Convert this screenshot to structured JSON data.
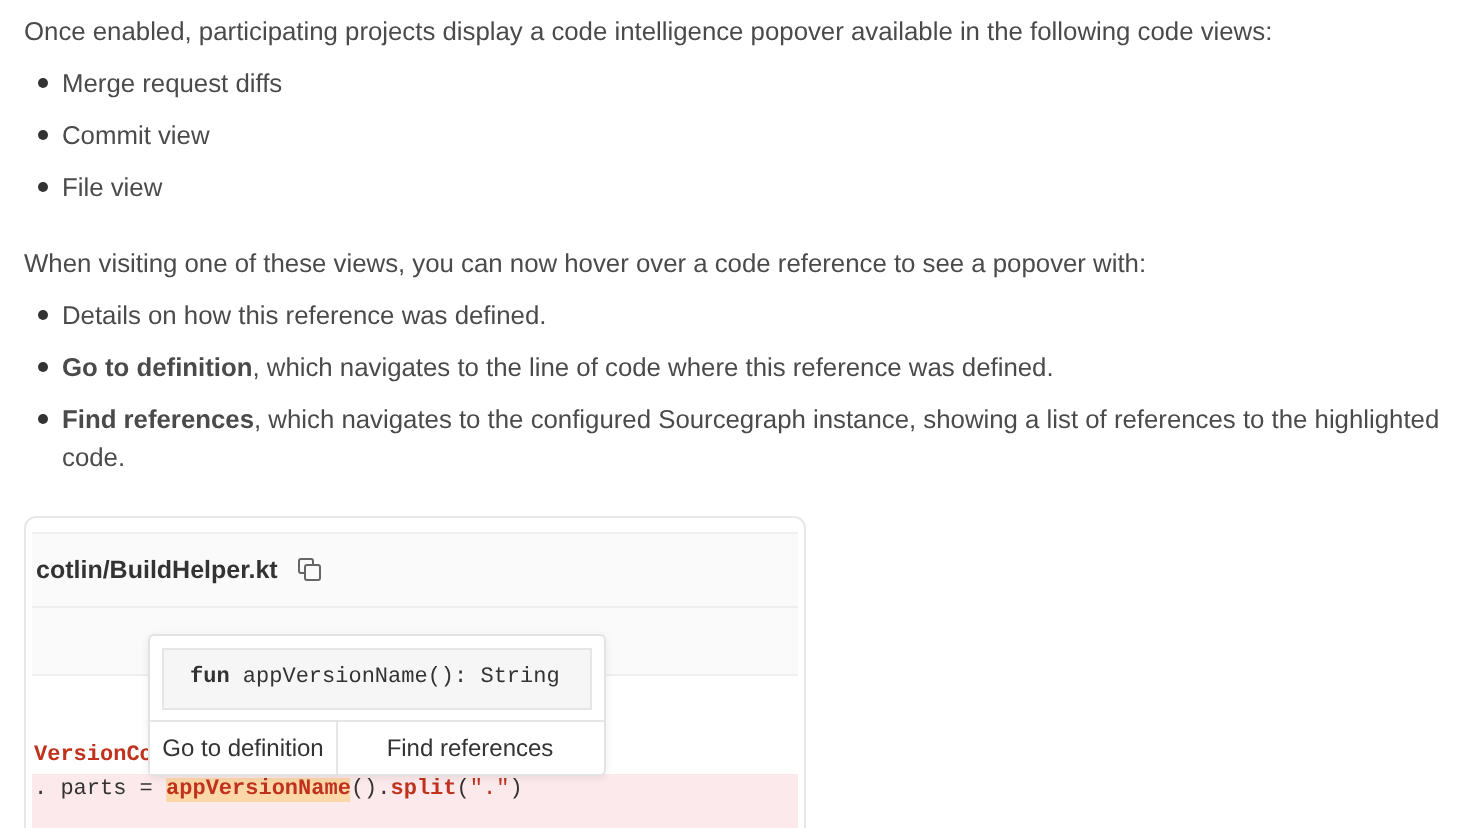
{
  "intro": "Once enabled, participating projects display a code intelligence popover available in the following code views:",
  "views": [
    "Merge request diffs",
    "Commit view",
    "File view"
  ],
  "hover_intro": "When visiting one of these views, you can now hover over a code reference to see a popover with:",
  "features": [
    "Details on how this reference was defined.",
    "**Go to definition**, which navigates to the line of code where this reference was defined.",
    "**Find references**, which navigates to the configured Sourcegraph instance, showing a list of references to the highlighted code."
  ],
  "screenshot": {
    "file_path": "cotlin/BuildHelper.kt",
    "code_lines": [
      {
        "kind": "plain",
        "tokens": [
          {
            "kind": "declaration",
            "text": "VersionCo"
          }
        ]
      },
      {
        "kind": "removed",
        "tokens": [
          {
            "kind": "plain",
            "text": ". parts = "
          },
          {
            "kind": "highlight",
            "text": "appVersionName"
          },
          {
            "kind": "plain",
            "text": "()."
          },
          {
            "kind": "function",
            "text": "split"
          },
          {
            "kind": "plain",
            "text": "("
          },
          {
            "kind": "string",
            "text": "\".\""
          },
          {
            "kind": "plain",
            "text": ")"
          }
        ]
      }
    ],
    "popover": {
      "signature": "**fun** appVersionName(): String",
      "actions": [
        "Go to definition",
        "Find references"
      ]
    }
  }
}
